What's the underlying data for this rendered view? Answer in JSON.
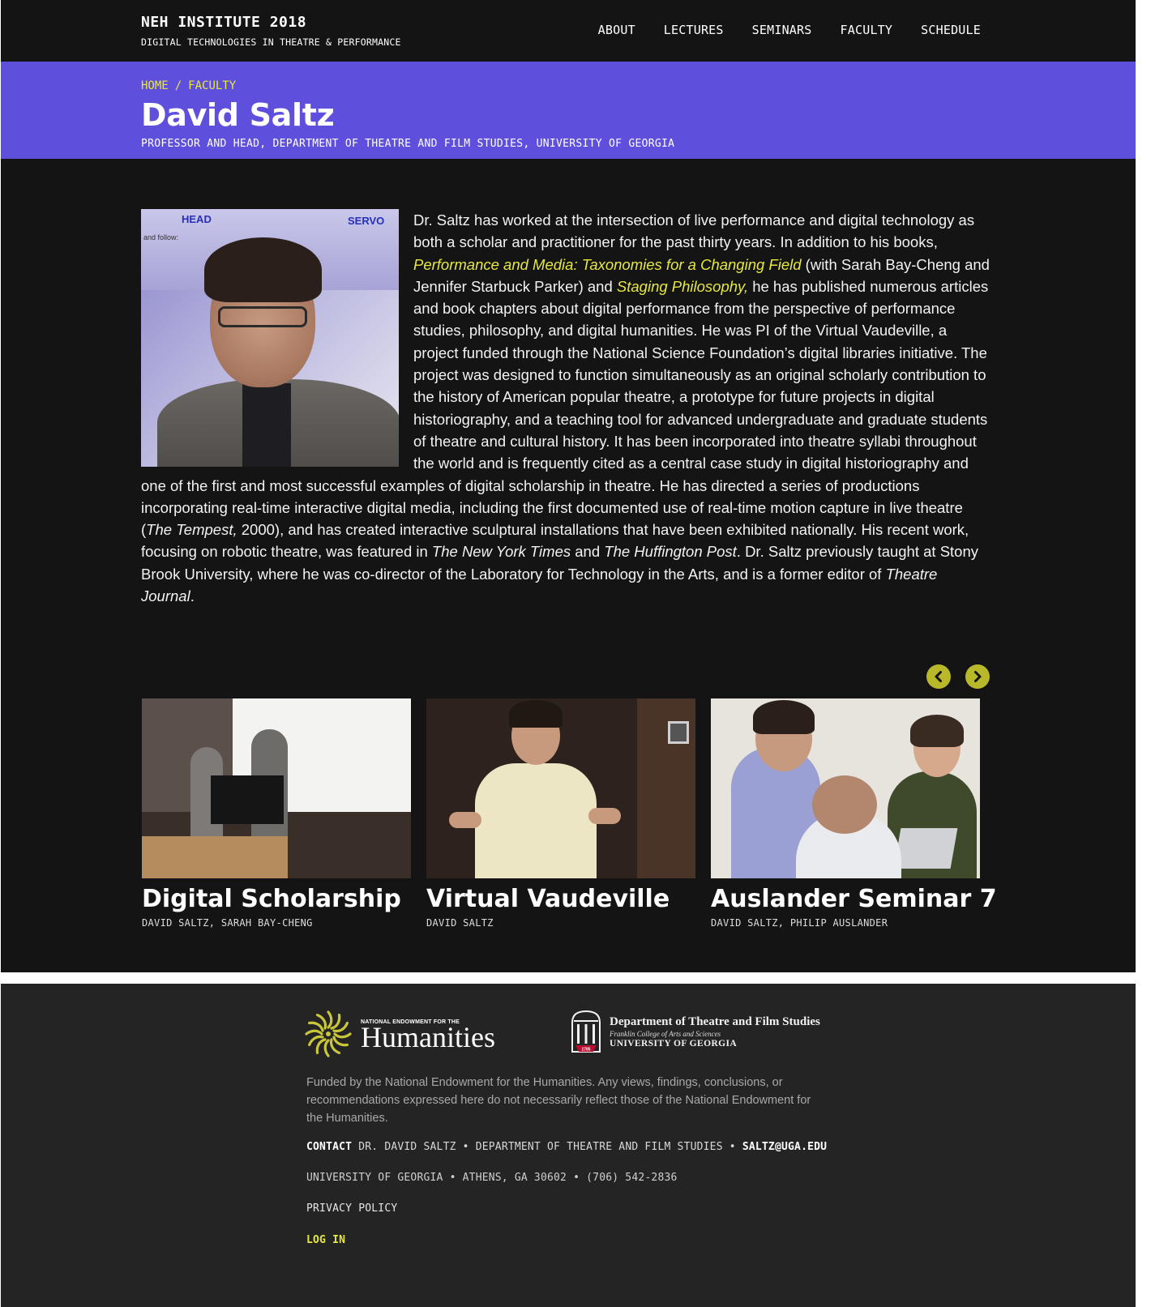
{
  "header": {
    "site_title": "NEH INSTITUTE 2018",
    "site_subtitle": "DIGITAL TECHNOLOGIES IN THEATRE & PERFORMANCE",
    "nav": [
      "ABOUT",
      "LECTURES",
      "SEMINARS",
      "FACULTY",
      "SCHEDULE"
    ]
  },
  "hero": {
    "breadcrumb": [
      "HOME",
      "/",
      "FACULTY"
    ],
    "name": "David Saltz",
    "title": "PROFESSOR AND HEAD, DEPARTMENT OF THEATRE AND FILM STUDIES, UNIVERSITY OF GEORGIA"
  },
  "portrait": {
    "label_left": "HEAD",
    "label_right": "SERVO",
    "label_small": "and follow:"
  },
  "bio": {
    "p1": "Dr. Saltz has worked at the intersection of live performance and digital technology as both a scholar and practitioner for the past thirty years. In addition to his books, ",
    "book1": "Performance and Media: Taxonomies for a Changing Field",
    "p2": " (with Sarah Bay-Cheng and Jennifer Starbuck Parker) and ",
    "book2": "Staging Philosophy,",
    "p3": " he has published numerous articles and book chapters about digital performance from the perspective of performance studies, philosophy, and digital humanities. He was PI of the Virtual Vaudeville, a project funded through the National Science Foundation’s digital libraries initiative. The project was designed to function simultaneously as an original scholarly contribution to the history of American popular theatre, a prototype for future projects in digital historiography, and a teaching tool for advanced undergraduate and graduate students of theatre and cultural history. It has been incorporated into theatre syllabi throughout the world and is frequently cited as a central case study in digital historiography and one of the first and most successful examples of digital scholarship in theatre. He has directed a series of productions incorporating real-time interactive digital media, including the first documented use of real-time motion capture in live theatre (",
    "work1": "The Tempest,",
    "p4": " 2000), and has created interactive sculptural installations that have been exhibited nationally. His recent work, focusing on robotic theatre, was featured in ",
    "pub1": "The New York Times",
    "p5": " and ",
    "pub2": "The Huffington Post",
    "p6": ". Dr. Saltz previously taught at Stony Brook University, where he was co-director of the Laboratory for Technology in the Arts, and is a former editor of ",
    "pub3": "Theatre Journal",
    "p7": "."
  },
  "cards": [
    {
      "title": "Digital Scholarship",
      "authors": "DAVID SALTZ, SARAH BAY-CHENG"
    },
    {
      "title": "Virtual Vaudeville",
      "authors": "DAVID SALTZ"
    },
    {
      "title": "Auslander Seminar 7",
      "authors": "DAVID SALTZ, PHILIP AUSLANDER"
    }
  ],
  "footer": {
    "neh_small": "NATIONAL ENDOWMENT FOR THE",
    "neh_big": "Humanities",
    "uga_line1": "Department of Theatre and Film Studies",
    "uga_line2": "Franklin College of Arts and Sciences",
    "uga_line3": "UNIVERSITY OF GEORGIA",
    "uga_seal_year": "1785",
    "disclaimer": "Funded by the National Endowment for the Humanities. Any views, findings, conclusions, or recommendations expressed here do not necessarily reflect those of the National Endowment for the Humanities.",
    "contact_label": "CONTACT",
    "contact_name": "DR. DAVID SALTZ",
    "contact_sep": "•",
    "contact_dept": "DEPARTMENT OF THEATRE AND FILM STUDIES",
    "contact_email": "SALTZ@UGA.EDU",
    "address": "UNIVERSITY OF GEORGIA • ATHENS, GA 30602 • (706) 542-2836",
    "privacy": "PRIVACY POLICY",
    "login": "LOG IN"
  },
  "colors": {
    "accent_purple": "#5f4fdd",
    "accent_yellow": "#e6e840",
    "arrow_olive": "#b8b82a",
    "page_dark": "#141414",
    "footer_dark": "#242424"
  }
}
